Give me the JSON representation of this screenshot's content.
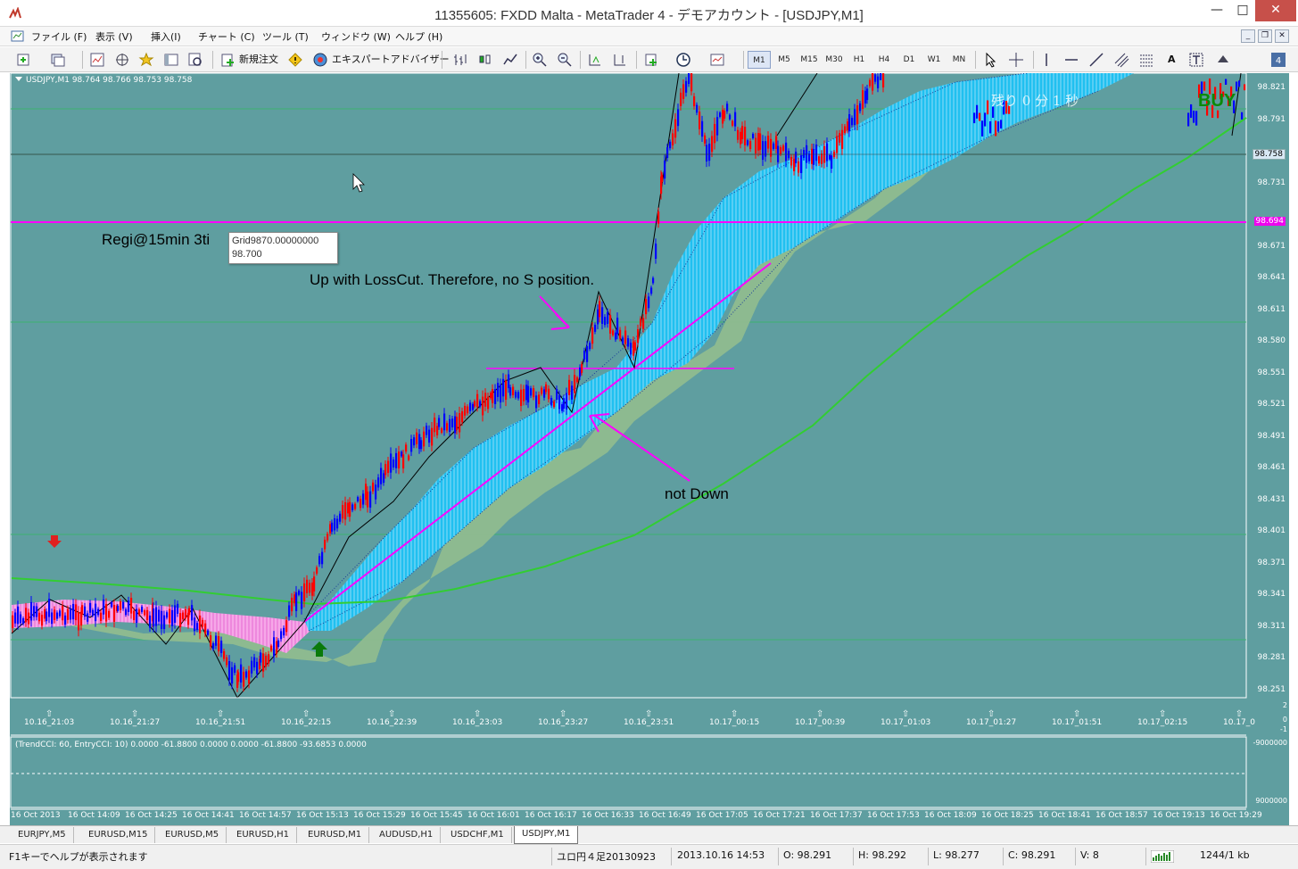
{
  "window": {
    "title": "11355605: FXDD Malta - MetaTrader 4 - デモアカウント - [USDJPY,M1]",
    "minimize": "—",
    "maximize": "□",
    "close": "✕"
  },
  "menu": {
    "items": [
      "ファイル (F)",
      "表示 (V)",
      "挿入(I)",
      "チャート (C)",
      "ツール (T)",
      "ウィンドウ (W)",
      "ヘルプ (H)"
    ]
  },
  "toolbar": {
    "new_order": "新規注文",
    "expert_advisor": "エキスパートアドバイザー",
    "timeframes": [
      "M1",
      "M5",
      "M15",
      "M30",
      "H1",
      "H4",
      "D1",
      "W1",
      "MN"
    ],
    "active_timeframe": "M1",
    "text_tool": "A"
  },
  "chart": {
    "symbol_info": "USDJPY,M1  98.764 98.766 98.753 98.758",
    "annotations": {
      "regi": "Regi@15min 3ti",
      "up_losscut": "Up with LossCut. Therefore, no S position.",
      "not_down": "not Down",
      "buy": "BUY",
      "countdown": "残り 0 分 1 秒"
    },
    "tooltip": {
      "line1": "Grid9870.00000000",
      "line2": "98.700"
    },
    "price_axis": [
      "98.821",
      "98.791",
      "98.758",
      "98.731",
      "98.694",
      "98.671",
      "98.641",
      "98.611",
      "98.580",
      "98.551",
      "98.521",
      "98.491",
      "98.461",
      "98.431",
      "98.401",
      "98.371",
      "98.341",
      "98.311",
      "98.281",
      "98.251"
    ],
    "current_price": "98.758",
    "magenta_price": "98.694",
    "time_axis": [
      "10.16_21:03",
      "10.16_21:27",
      "10.16_21:51",
      "10.16_22:15",
      "10.16_22:39",
      "10.16_23:03",
      "10.16_23:27",
      "10.16_23:51",
      "10.17_00:15",
      "10.17_00:39",
      "10.17_01:03",
      "10.17_01:27",
      "10.17_01:51",
      "10.17_02:15",
      "10.17_0"
    ],
    "indicator_label": "(TrendCCI: 60, EntryCCI: 10)  0.0000 -61.8800 0.0000 0.0000 -61.8800 -93.6853 0.0000",
    "indicator_scale": [
      "2",
      "0",
      "-1",
      "-9000000",
      "9000000"
    ],
    "bottom_axis": [
      "16 Oct 2013",
      "16 Oct 14:09",
      "16 Oct 14:25",
      "16 Oct 14:41",
      "16 Oct 14:57",
      "16 Oct 15:13",
      "16 Oct 15:29",
      "16 Oct 15:45",
      "16 Oct 16:01",
      "16 Oct 16:17",
      "16 Oct 16:33",
      "16 Oct 16:49",
      "16 Oct 17:05",
      "16 Oct 17:21",
      "16 Oct 17:37",
      "16 Oct 17:53",
      "16 Oct 18:09",
      "16 Oct 18:25",
      "16 Oct 18:41",
      "16 Oct 18:57",
      "16 Oct 19:13",
      "16 Oct 19:29"
    ]
  },
  "tabs": [
    "EURJPY,M5",
    "EURUSD,M15",
    "EURUSD,M5",
    "EURUSD,H1",
    "EURUSD,M1",
    "AUDUSD,H1",
    "USDCHF,M1",
    "USDJPY,M1"
  ],
  "active_tab": "USDJPY,M1",
  "status": {
    "help": "F1キーでヘルプが表示されます",
    "profile": "ユロ円４足20130923",
    "datetime": "2013.10.16 14:53",
    "open": "O: 98.291",
    "high": "H: 98.292",
    "low": "L: 98.277",
    "close": "C: 98.291",
    "volume": "V: 8",
    "traffic": "1244/1 kb"
  },
  "colors": {
    "chart_bg": "#5f9ea0",
    "bull_candle": "#0000ff",
    "bear_candle": "#ff0000",
    "envelope_fill": "#00bfff",
    "cloud": "#8fbc8f",
    "ma": "#32cd32",
    "magenta": "#ff00ff"
  }
}
